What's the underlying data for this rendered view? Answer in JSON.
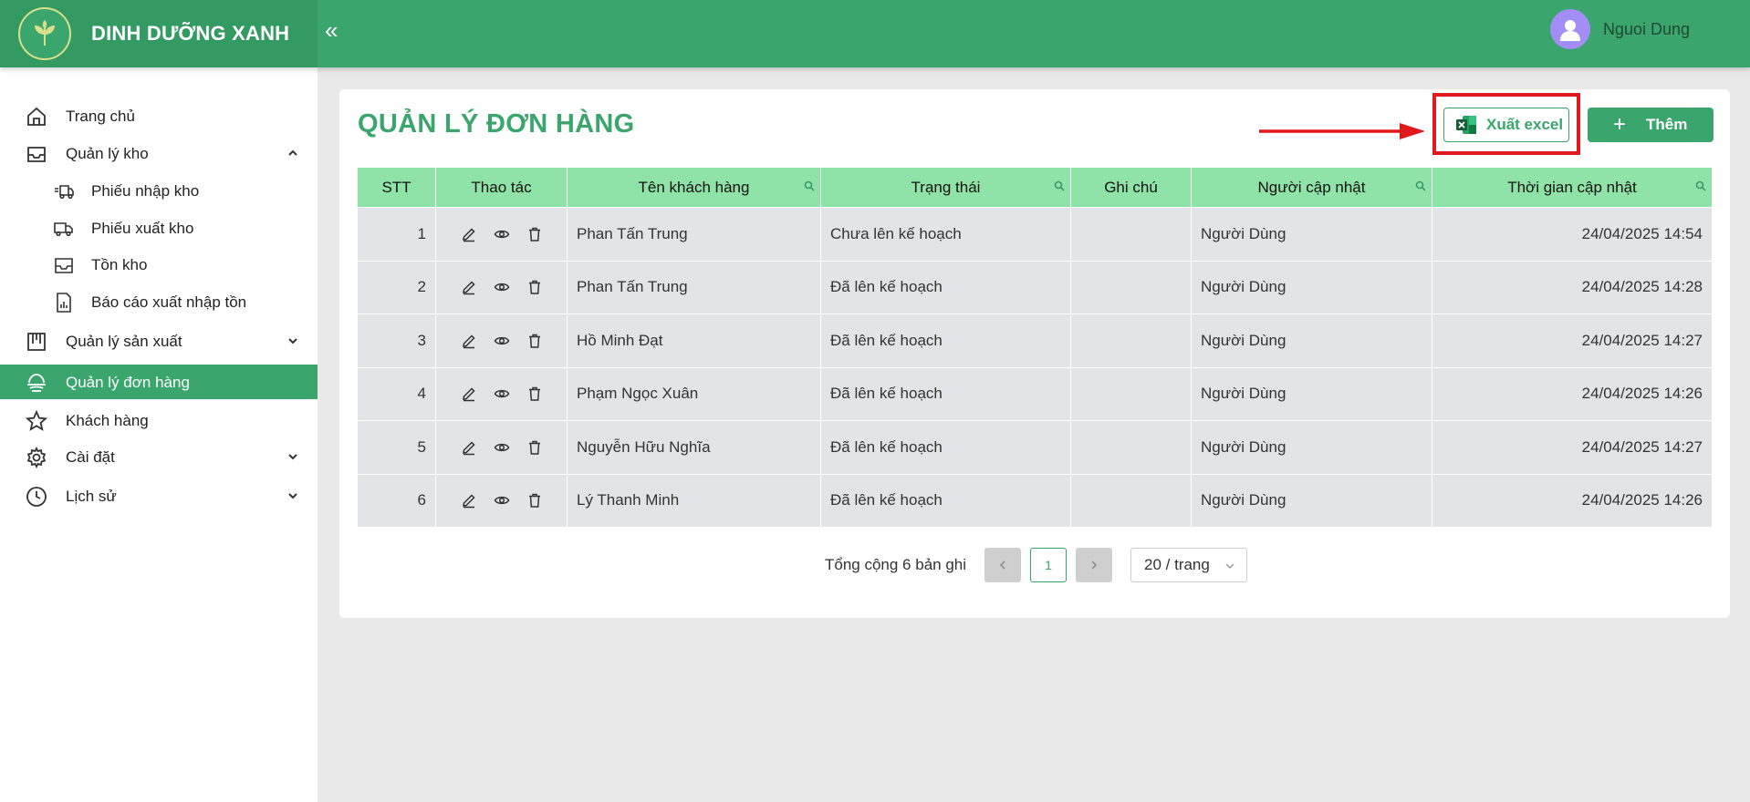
{
  "app": {
    "brand": "DINH DƯỠNG XANH",
    "collapse_icon": "double-chevron-left-icon"
  },
  "header": {
    "user_name": "Nguoi Dung"
  },
  "sidebar": {
    "items": [
      {
        "label": "Trang chủ"
      },
      {
        "label": "Quản lý kho",
        "expanded": true
      },
      {
        "label": "Phiếu nhập kho"
      },
      {
        "label": "Phiếu xuất kho"
      },
      {
        "label": "Tồn kho"
      },
      {
        "label": "Báo cáo xuất nhập tồn"
      },
      {
        "label": "Quản lý sản xuất"
      },
      {
        "label": "Quản lý đơn hàng",
        "active": true
      },
      {
        "label": "Khách hàng"
      },
      {
        "label": "Cài đặt"
      },
      {
        "label": "Lịch sử"
      }
    ]
  },
  "main": {
    "title": "QUẢN LÝ ĐƠN HÀNG",
    "export_label": "Xuất excel",
    "add_label": "Thêm",
    "columns": [
      "STT",
      "Thao tác",
      "Tên khách hàng",
      "Trạng thái",
      "Ghi chú",
      "Người cập nhật",
      "Thời gian cập nhật"
    ],
    "rows": [
      {
        "stt": "1",
        "customer": "Phan Tấn Trung",
        "status": "Chưa lên kế hoạch",
        "note": "",
        "updated_by": "Người Dùng",
        "updated_at": "24/04/2025 14:54"
      },
      {
        "stt": "2",
        "customer": "Phan Tấn Trung",
        "status": "Đã lên kế hoạch",
        "note": "",
        "updated_by": "Người Dùng",
        "updated_at": "24/04/2025 14:28"
      },
      {
        "stt": "3",
        "customer": "Hồ Minh Đạt",
        "status": "Đã lên kế hoạch",
        "note": "",
        "updated_by": "Người Dùng",
        "updated_at": "24/04/2025 14:27"
      },
      {
        "stt": "4",
        "customer": "Phạm Ngọc Xuân",
        "status": "Đã lên kế hoạch",
        "note": "",
        "updated_by": "Người Dùng",
        "updated_at": "24/04/2025 14:26"
      },
      {
        "stt": "5",
        "customer": "Nguyễn Hữu Nghĩa",
        "status": "Đã lên kế hoạch",
        "note": "",
        "updated_by": "Người Dùng",
        "updated_at": "24/04/2025 14:27"
      },
      {
        "stt": "6",
        "customer": "Lý Thanh Minh",
        "status": "Đã lên kế hoạch",
        "note": "",
        "updated_by": "Người Dùng",
        "updated_at": "24/04/2025 14:26"
      }
    ]
  },
  "pagination": {
    "total_text": "Tổng cộng 6 bản ghi",
    "current_page": "1",
    "page_size": "20 / trang",
    "prev_icon": "chevron-left-icon",
    "next_icon": "chevron-right-icon"
  },
  "colors": {
    "primary": "#3aa56c",
    "header_green": "#339a62",
    "table_header": "#8fe3a8",
    "row_bg": "#e3e4e8",
    "highlight_red": "#e0191c"
  }
}
